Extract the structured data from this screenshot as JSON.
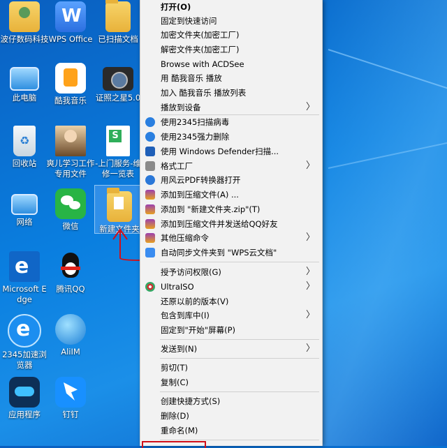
{
  "desktop": {
    "icons": [
      {
        "label": "波仔数码科技"
      },
      {
        "label": "WPS Office"
      },
      {
        "label": "已扫描文档"
      },
      {
        "label": "此电脑"
      },
      {
        "label": "酷我音乐"
      },
      {
        "label": "证照之星5.0"
      },
      {
        "label": "回收站"
      },
      {
        "label": "爽儿学习工作专用文件"
      },
      {
        "label": "-上门服务-维修一览表"
      },
      {
        "label": "网络"
      },
      {
        "label": "微信"
      },
      {
        "label": "新建文件夹"
      },
      {
        "label": "Microsoft Edge"
      },
      {
        "label": "腾讯QQ"
      },
      {
        "label": "2345加速浏览器"
      },
      {
        "label": "AliIM"
      },
      {
        "label": "应用程序"
      },
      {
        "label": "钉钉"
      }
    ]
  },
  "context_menu": {
    "items": [
      {
        "label": "打开(O)"
      },
      {
        "label": "固定到快速访问"
      },
      {
        "label": "加密文件夹(加密工厂)"
      },
      {
        "label": "解密文件夹(加密工厂)"
      },
      {
        "label": "Browse with ACDSee"
      },
      {
        "label": "用 酷我音乐 播放"
      },
      {
        "label": "加入 酷我音乐 播放列表"
      },
      {
        "label": "播放到设备"
      },
      {
        "label": "使用2345扫描病毒"
      },
      {
        "label": "使用2345强力删除"
      },
      {
        "label": "使用 Windows Defender扫描..."
      },
      {
        "label": "格式工厂"
      },
      {
        "label": "用风云PDF转换器打开"
      },
      {
        "label": "添加到压缩文件(A) ..."
      },
      {
        "label": "添加到 \"新建文件夹.zip\"(T)"
      },
      {
        "label": "添加到压缩文件并发送给QQ好友"
      },
      {
        "label": "其他压缩命令"
      },
      {
        "label": "自动同步文件夹到 \"WPS云文档\""
      },
      {
        "label": "授予访问权限(G)"
      },
      {
        "label": "UltraISO"
      },
      {
        "label": "还原以前的版本(V)"
      },
      {
        "label": "包含到库中(I)"
      },
      {
        "label": "固定到\"开始\"屏幕(P)"
      },
      {
        "label": "发送到(N)"
      },
      {
        "label": "剪切(T)"
      },
      {
        "label": "复制(C)"
      },
      {
        "label": "创建快捷方式(S)"
      },
      {
        "label": "删除(D)"
      },
      {
        "label": "重命名(M)"
      }
    ]
  },
  "colors": {
    "accent": "#1a7fe0",
    "menu_bg": "#f2f2f2",
    "annotation": "#d0101a"
  }
}
